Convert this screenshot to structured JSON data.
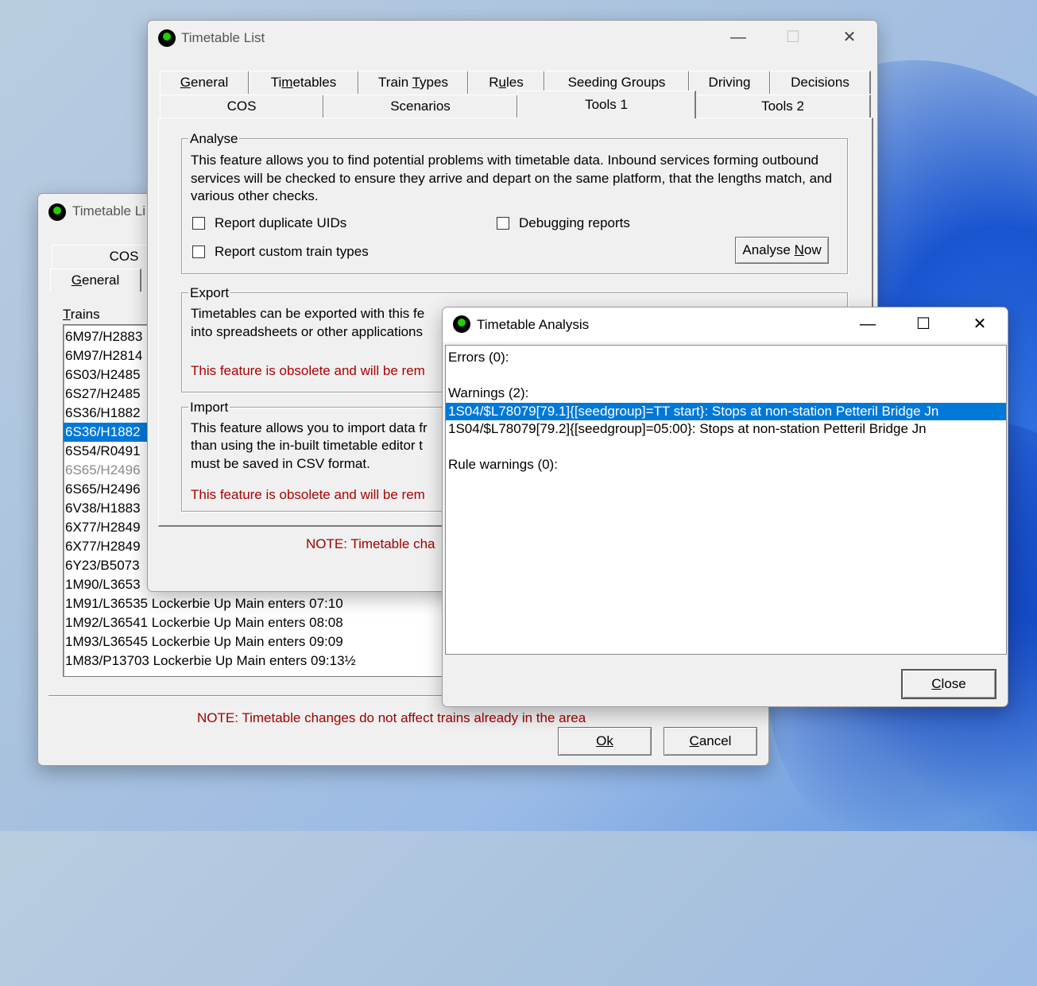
{
  "back_window": {
    "title": "Timetable Li",
    "tabs_row1": [
      {
        "label": "COS"
      }
    ],
    "tabs_row2": [
      {
        "label": "General",
        "underline": "G"
      }
    ],
    "trains_label": "Trains",
    "trains": [
      "6M97/H2883",
      "6M97/H2814",
      "6S03/H2485",
      "6S27/H2485",
      "6S36/H1882",
      "6S36/H1882",
      "6S54/R0491",
      "6S65/H2496",
      "6S65/H2496",
      "6V38/H1883",
      "6X77/H2849",
      "6X77/H2849",
      "6Y23/B5073",
      "1M90/L3653",
      "1M91/L36535 Lockerbie Up Main enters 07:10",
      "1M92/L36541 Lockerbie Up Main enters 08:08",
      "1M93/L36545 Lockerbie Up Main enters 09:09",
      "1M83/P13703 Lockerbie Up Main enters 09:13½"
    ],
    "selected_index": 5,
    "gray_index": 7,
    "note": "NOTE: Timetable changes do not affect trains already in the area",
    "ok_label": "Ok",
    "cancel_label": "Cancel"
  },
  "main_window": {
    "title": "Timetable List",
    "controls": {
      "minimize": "—",
      "maximize": "☐",
      "close": "✕"
    },
    "tabs_row1": [
      "General",
      "Timetables",
      "Train Types",
      "Rules",
      "Seeding Groups",
      "Driving",
      "Decisions"
    ],
    "tabs_row2": [
      "COS",
      "Scenarios",
      "Tools 1",
      "Tools 2"
    ],
    "analyse": {
      "legend": "Analyse",
      "description": "This feature allows you to find potential problems with timetable data. Inbound services forming outbound services will be checked to ensure they arrive and depart on the same platform, that the lengths match, and various other checks.",
      "cb_duplicate": "Report duplicate UIDs",
      "cb_debug": "Debugging reports",
      "cb_custom": "Report custom train types",
      "analyse_button": "Analyse Now"
    },
    "export": {
      "legend": "Export",
      "line1": "Timetables can be exported with this fe",
      "line2": "into spreadsheets or other applications",
      "obsolete": "This feature is obsolete and will be rem"
    },
    "import": {
      "legend": "Import",
      "line1": "This feature allows you to import data fr",
      "line2": "than using the in-built timetable editor t",
      "line3": "must be saved in CSV format.",
      "obsolete": "This feature is obsolete and will be rem"
    },
    "note": "NOTE: Timetable cha"
  },
  "analysis_window": {
    "title": "Timetable Analysis",
    "controls": {
      "minimize": "—",
      "maximize": "☐",
      "close": "✕"
    },
    "lines": [
      "Errors (0):",
      "",
      "Warnings (2):",
      "1S04/$L78079[79.1]{[seedgroup]=TT start}: Stops at non-station Petteril Bridge Jn",
      "1S04/$L78079[79.2]{[seedgroup]=05:00}: Stops at non-station Petteril Bridge Jn",
      "",
      "Rule warnings (0):"
    ],
    "selected_line": 3,
    "close_label": "Close"
  },
  "colors": {
    "selection": "#0078d7",
    "obsolete_text": "#b00000",
    "note_text": "#a00000",
    "icon_green": "#20d000"
  }
}
